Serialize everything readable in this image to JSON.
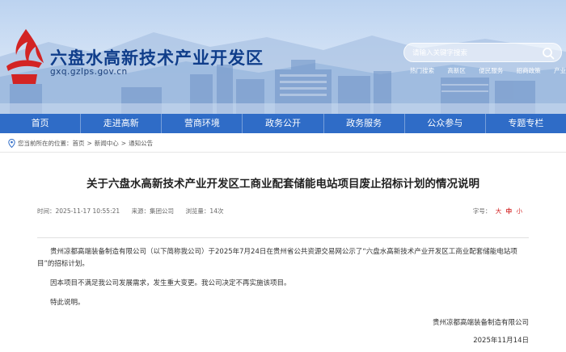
{
  "header": {
    "site_title": "六盘水高新技术产业开发区",
    "domain": "gxq.gzlps.gov.cn",
    "search_placeholder": "请输入关键字搜索",
    "hot_words": [
      "热门搜索",
      "高新区",
      "便民服务",
      "招商政策",
      "产业布局"
    ]
  },
  "nav": {
    "items": [
      "首页",
      "走进高新",
      "营商环境",
      "政务公开",
      "政务服务",
      "公众参与",
      "专题专栏"
    ]
  },
  "breadcrumb": {
    "prefix": "您当前所在的位置：",
    "items": [
      "首页",
      "新闻中心",
      "通知公告"
    ],
    "separator": ">"
  },
  "article": {
    "title": "关于六盘水高新技术产业开发区工商业配套储能电站项目废止招标计划的情况说明",
    "time": "时间：2025-11-17 10:55:21",
    "source": "来源：集团公司",
    "views": "浏览量：14次",
    "font_size_label": "字号：",
    "font_sizes": [
      "大",
      "中",
      "小"
    ],
    "paragraphs": [
      "贵州凉都高端装备制造有限公司（以下简称我公司）于2025年7月24日在贵州省公共资源交易网公示了“六盘水高新技术产业开发区工商业配套储能电站项目”的招标计划。",
      "因本项目不满足我公司发展需求，发生重大变更。我公司决定不再实施该项目。",
      "特此说明。"
    ],
    "signer": "贵州凉都高端装备制造有限公司",
    "sign_date": "2025年11月14日"
  },
  "colors": {
    "nav_bg": "#2f6cc7",
    "title_blue": "#0f3d8a",
    "accent_red": "#d32424"
  }
}
